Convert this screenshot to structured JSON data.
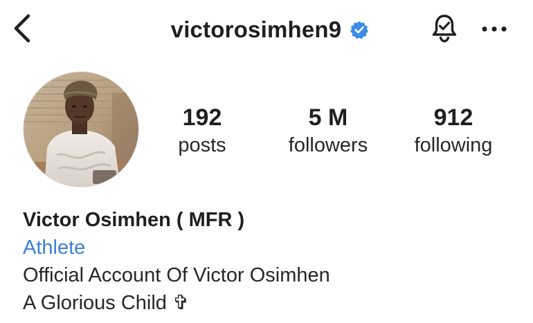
{
  "header": {
    "username": "victorosimhen9",
    "verified": true,
    "icons": {
      "back": "chevron-left-icon",
      "verified": "verified-badge-icon",
      "notifications": "bell-check-icon",
      "more": "more-horizontal-icon"
    }
  },
  "stats": {
    "posts": {
      "value": "192",
      "label": "posts"
    },
    "followers": {
      "value": "5 M",
      "label": "followers"
    },
    "following": {
      "value": "912",
      "label": "following"
    }
  },
  "bio": {
    "name": "Victor Osimhen ( MFR )",
    "category": "Athlete",
    "line1": "Official Account Of Victor Osimhen",
    "line2": "A Glorious Child ✞"
  },
  "colors": {
    "text": "#262626",
    "category_link": "#3c7fd9",
    "verified_badge": "#3c8ce7"
  }
}
